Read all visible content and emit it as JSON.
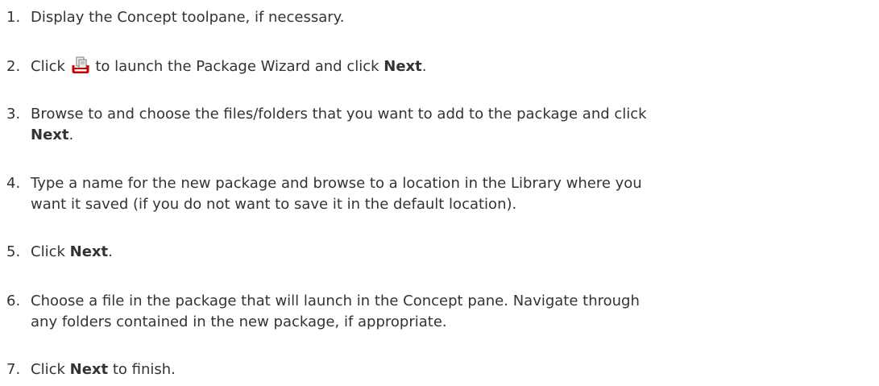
{
  "steps": [
    {
      "number": "1.",
      "text": "Display the Concept toolpane, if necessary."
    },
    {
      "number": "2.",
      "pre": "Click",
      "icon": "package-wizard-icon",
      "mid": "to launch the Package Wizard and click",
      "bold": "Next",
      "post": "."
    },
    {
      "number": "3.",
      "line1": "Browse to and choose the files/folders that you want to add to the package and click",
      "bold": "Next",
      "post": "."
    },
    {
      "number": "4.",
      "line1": "Type a name for the new package and browse to a location in the Library where you",
      "line2": "want it saved (if you do not want to save it in the default location)."
    },
    {
      "number": "5.",
      "pre": "Click",
      "bold": "Next",
      "post": "."
    },
    {
      "number": "6.",
      "line1": "Choose a file in the package that will launch in the Concept pane. Navigate through",
      "line2": "any folders contained in the new package, if appropriate."
    },
    {
      "number": "7.",
      "pre": "Click",
      "bold": "Next",
      "post": "to finish."
    }
  ],
  "colors": {
    "text": "#333333",
    "icon_red": "#cc0000",
    "icon_doc": "#e8e8e8"
  }
}
